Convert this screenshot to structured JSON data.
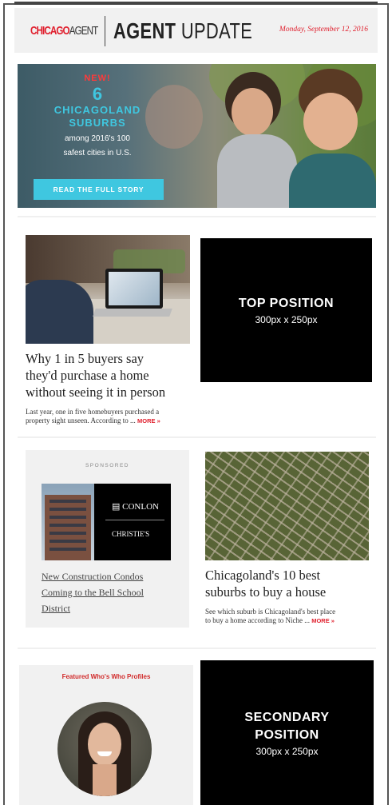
{
  "header": {
    "logo_chicago": "CHICAGO",
    "logo_agent": "AGENT",
    "title_bold": "AGENT",
    "title_rest": " UPDATE",
    "date": "Monday, September 12, 2016"
  },
  "hero": {
    "new_label": "NEW!",
    "number": "6",
    "line1": "CHICAGOLAND",
    "line2": "SUBURBS",
    "sub1": "among 2016's 100",
    "sub2": "safest cities in U.S.",
    "button": "READ THE FULL STORY"
  },
  "article1": {
    "title_l1": "Why 1 in 5 buyers say",
    "title_l2": "they'd purchase a home",
    "title_l3": "without seeing it in person",
    "desc_l1": "Last year, one in five homebuyers purchased a",
    "desc_l2": "property sight unseen. According to",
    "ellipsis": "...",
    "more": "MORE »"
  },
  "ad_top": {
    "title": "TOP POSITION",
    "size": "300px x 250px"
  },
  "sponsored": {
    "label": "SPONSORED",
    "brand_l1": "CONLON",
    "brand_l2": "CHRISTIE'S",
    "link_l1": "New Construction Condos",
    "link_l2": "Coming to the Bell School",
    "link_l3": "District"
  },
  "article2": {
    "title_l1": "Chicagoland's 10 best",
    "title_l2": "suburbs to buy a house",
    "desc_l1": "See which suburb is Chicagoland's best place",
    "desc_l2": "to buy a home according to Niche",
    "ellipsis": "...",
    "more": "MORE »"
  },
  "featured": {
    "label": "Featured Who's Who Profiles"
  },
  "ad_secondary": {
    "title_l1": "SECONDARY",
    "title_l2": "POSITION",
    "size": "300px x 250px"
  },
  "colors": {
    "brand_red": "#e01f2d",
    "accent_cyan": "#3fc7e0",
    "ad_black": "#000000"
  }
}
